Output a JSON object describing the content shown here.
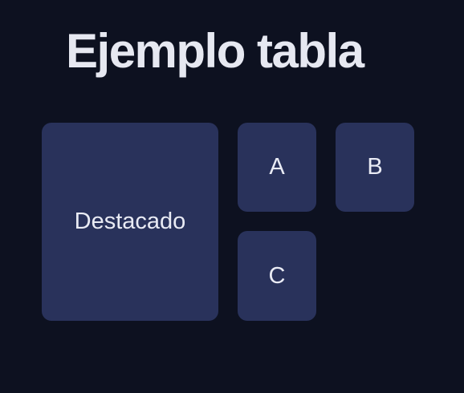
{
  "page": {
    "title": "Ejemplo tabla"
  },
  "grid": {
    "featured_label": "Destacado",
    "a_label": "A",
    "b_label": "B",
    "c_label": "C"
  },
  "colors": {
    "background": "#0d1120",
    "tile": "#29325b",
    "text": "#e6e8f1"
  }
}
